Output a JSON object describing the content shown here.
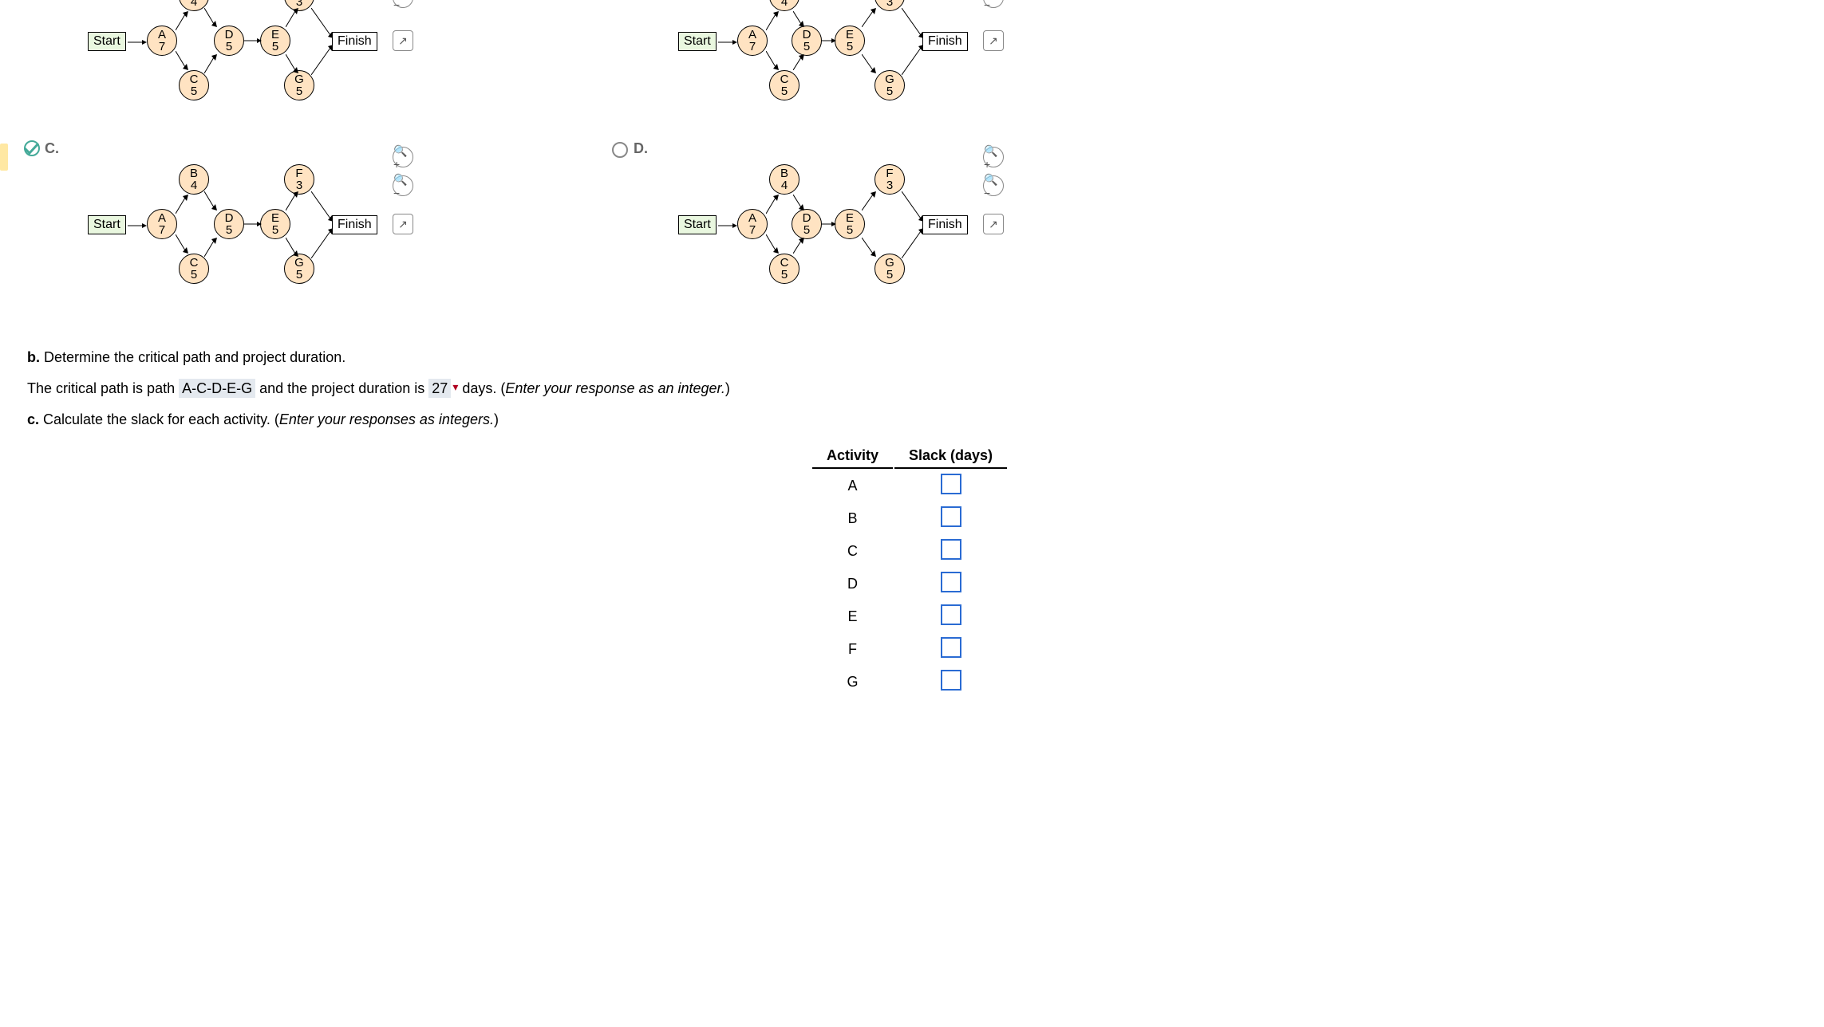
{
  "diagram_labels": {
    "start": "Start",
    "finish": "Finish"
  },
  "optC": "C.",
  "optD": "D.",
  "nodes": {
    "A": {
      "n": "A",
      "v": "7"
    },
    "B": {
      "n": "B",
      "v": "4"
    },
    "C": {
      "n": "C",
      "v": "5"
    },
    "D": {
      "n": "D",
      "v": "5"
    },
    "E": {
      "n": "E",
      "v": "5"
    },
    "F": {
      "n": "F",
      "v": "3"
    },
    "G": {
      "n": "G",
      "v": "5"
    }
  },
  "icons": {
    "zoomin": "⊕",
    "zoomout": "⊖",
    "popout": "↗"
  },
  "partB": {
    "label": "b.",
    "prompt": "Determine the critical path and project duration.",
    "sentence_pre": "The critical path is path",
    "critical_path": "A-C-D-E-G",
    "sentence_mid": "and the project duration is",
    "duration": "27",
    "sentence_post": "days. (",
    "hint": "Enter your response as an integer.",
    "sentence_end": ")"
  },
  "partC": {
    "label": "c.",
    "prompt": "Calculate the slack for each activity. (",
    "hint": "Enter your responses as integers.",
    "prompt_end": ")",
    "headers": {
      "activity": "Activity",
      "slack": "Slack (days)"
    },
    "rows": [
      "A",
      "B",
      "C",
      "D",
      "E",
      "F",
      "G"
    ]
  }
}
